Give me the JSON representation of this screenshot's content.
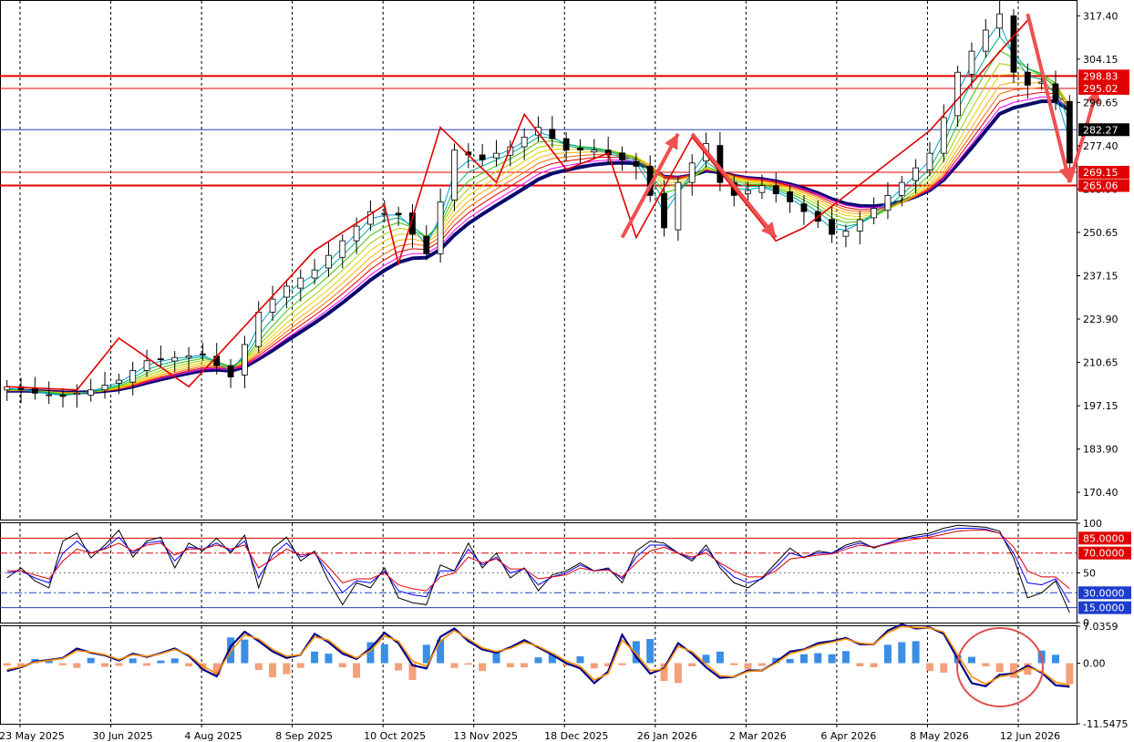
{
  "chart_data": [
    {
      "panel": "price",
      "type": "candlestick",
      "ylim": [
        162.0,
        322.0
      ],
      "y_ticks": [
        "317.40",
        "304.15",
        "290.65",
        "277.40",
        "263.90",
        "250.65",
        "237.15",
        "223.90",
        "210.65",
        "197.15",
        "183.90",
        "170.40"
      ],
      "x_labels": [
        "23 May 2025",
        "30 Jun 2025",
        "4 Aug 2025",
        "8 Sep 2025",
        "10 Oct 2025",
        "13 Nov 2025",
        "18 Dec 2025",
        "26 Jan 2026",
        "2 Mar 2026",
        "6 Apr 2026",
        "8 May 2026",
        "12 Jun 2026"
      ],
      "horizontal_levels": [
        {
          "label": "298.83",
          "value": 298.83,
          "color": "#e00000"
        },
        {
          "label": "295.02",
          "value": 295.02,
          "color": "#e00000"
        },
        {
          "label": "282.27",
          "value": 282.27,
          "color": "#2040c0"
        },
        {
          "label": "269.15",
          "value": 269.15,
          "color": "#e00000"
        },
        {
          "label": "265.06",
          "value": 265.06,
          "color": "#e00000"
        }
      ],
      "close_anchors": [
        [
          0,
          203
        ],
        [
          2,
          201
        ],
        [
          4,
          200
        ],
        [
          6,
          202
        ],
        [
          8,
          205
        ],
        [
          10,
          211
        ],
        [
          12,
          212
        ],
        [
          14,
          213
        ],
        [
          16,
          206
        ],
        [
          18,
          226
        ],
        [
          20,
          234
        ],
        [
          22,
          239
        ],
        [
          24,
          248
        ],
        [
          26,
          257
        ],
        [
          28,
          256
        ],
        [
          30,
          244
        ],
        [
          32,
          276
        ],
        [
          34,
          273
        ],
        [
          36,
          277
        ],
        [
          38,
          283
        ],
        [
          40,
          276
        ],
        [
          42,
          276
        ],
        [
          44,
          273
        ],
        [
          45,
          271
        ],
        [
          46,
          262
        ],
        [
          47,
          252
        ],
        [
          48,
          266
        ],
        [
          50,
          278
        ],
        [
          51,
          266
        ],
        [
          52,
          262
        ],
        [
          54,
          265
        ],
        [
          56,
          260
        ],
        [
          58,
          254
        ],
        [
          59,
          250
        ],
        [
          60,
          251
        ],
        [
          62,
          258
        ],
        [
          64,
          266
        ],
        [
          66,
          275
        ],
        [
          67,
          286
        ],
        [
          68,
          300
        ],
        [
          70,
          313
        ],
        [
          71,
          318
        ],
        [
          72,
          300
        ],
        [
          73,
          296
        ],
        [
          74,
          297
        ],
        [
          75,
          291
        ],
        [
          76,
          272
        ]
      ],
      "trend_zigzag": [
        [
          0,
          203
        ],
        [
          5,
          202
        ],
        [
          8,
          218
        ],
        [
          13,
          203
        ],
        [
          22,
          245
        ],
        [
          27,
          259
        ],
        [
          28,
          241
        ],
        [
          31,
          283
        ],
        [
          35,
          266
        ],
        [
          37,
          287
        ],
        [
          40,
          270
        ],
        [
          43,
          275
        ],
        [
          45,
          249
        ],
        [
          49,
          280
        ],
        [
          55,
          248
        ],
        [
          57,
          252
        ],
        [
          66,
          282
        ],
        [
          73,
          316
        ]
      ],
      "forecast_arrows": [
        [
          [
            44,
            249
          ],
          [
            48,
            281
          ]
        ],
        [
          [
            49,
            281
          ],
          [
            55,
            249
          ]
        ],
        [
          [
            73,
            318
          ],
          [
            76,
            266
          ]
        ],
        [
          [
            76,
            266
          ],
          [
            78,
            295
          ]
        ]
      ],
      "ma_ribbon_colors": [
        "#0a0a6e",
        "#ff00ff",
        "#e00000",
        "#ff6600",
        "#ffb000",
        "#e8d000",
        "#a0d000",
        "#40c000",
        "#00b080",
        "#00a0d0"
      ],
      "x_count": 77
    },
    {
      "panel": "stochastic",
      "type": "line",
      "ylim": [
        0,
        100
      ],
      "y_ticks": [
        "100",
        "50",
        "0"
      ],
      "levels": [
        {
          "label": "85.0000",
          "value": 85,
          "color": "#e00000"
        },
        {
          "label": "70.0000",
          "value": 70,
          "color": "#e00000"
        },
        {
          "label": "30.0000",
          "value": 30,
          "color": "#2040c0"
        },
        {
          "label": "15.0000",
          "value": 15,
          "color": "#2040c0"
        }
      ],
      "series": [
        {
          "color": "#000000",
          "values": [
            45,
            55,
            42,
            35,
            82,
            90,
            65,
            78,
            93,
            66,
            82,
            86,
            55,
            80,
            72,
            85,
            70,
            88,
            35,
            75,
            86,
            62,
            72,
            42,
            18,
            40,
            35,
            55,
            25,
            20,
            18,
            58,
            52,
            80,
            55,
            70,
            45,
            55,
            32,
            48,
            52,
            60,
            52,
            55,
            40,
            72,
            82,
            80,
            70,
            62,
            78,
            55,
            40,
            35,
            45,
            60,
            75,
            65,
            72,
            70,
            78,
            82,
            75,
            80,
            85,
            88,
            90,
            95,
            98,
            97,
            96,
            92,
            65,
            25,
            30,
            42,
            10
          ]
        },
        {
          "color": "#0000ff",
          "values": [
            50,
            52,
            45,
            40,
            70,
            82,
            70,
            75,
            86,
            70,
            80,
            82,
            62,
            76,
            74,
            80,
            72,
            82,
            45,
            68,
            80,
            66,
            70,
            50,
            30,
            42,
            40,
            52,
            32,
            28,
            26,
            52,
            52,
            74,
            58,
            66,
            50,
            54,
            38,
            46,
            50,
            58,
            52,
            54,
            44,
            66,
            78,
            78,
            70,
            64,
            74,
            58,
            46,
            40,
            44,
            56,
            70,
            66,
            70,
            70,
            76,
            80,
            76,
            80,
            84,
            86,
            88,
            92,
            95,
            95,
            94,
            90,
            70,
            40,
            38,
            44,
            20
          ]
        },
        {
          "color": "#e00000",
          "values": [
            52,
            52,
            48,
            44,
            62,
            74,
            70,
            74,
            80,
            72,
            78,
            80,
            68,
            74,
            74,
            78,
            74,
            78,
            55,
            64,
            74,
            68,
            70,
            56,
            40,
            44,
            44,
            50,
            38,
            34,
            32,
            46,
            50,
            66,
            60,
            64,
            54,
            54,
            44,
            46,
            48,
            55,
            52,
            53,
            46,
            60,
            72,
            76,
            70,
            66,
            70,
            60,
            52,
            46,
            46,
            52,
            64,
            66,
            68,
            69,
            74,
            78,
            76,
            79,
            82,
            84,
            86,
            89,
            92,
            93,
            93,
            90,
            76,
            52,
            46,
            46,
            34
          ]
        }
      ],
      "x_count": 77
    },
    {
      "panel": "macd",
      "type": "bar",
      "ylim": [
        -11.5475,
        7.0359
      ],
      "y_ticks": [
        "7.0359",
        "0.00",
        "-11.5475"
      ],
      "histogram": [
        -0.5,
        -0.6,
        0.8,
        0.6,
        -0.4,
        -0.9,
        1.0,
        -0.7,
        -0.5,
        0.9,
        -0.5,
        0.5,
        0.9,
        -0.6,
        -1.2,
        -2.4,
        4.9,
        4.5,
        -1.3,
        -2.7,
        -2.1,
        -0.9,
        2.2,
        1.8,
        -0.8,
        -2.8,
        4.0,
        3.6,
        -1.4,
        -3.2,
        3.5,
        4.5,
        -0.9,
        -0.3,
        -1.5,
        2.1,
        -0.8,
        -0.8,
        1.1,
        1.8,
        -0.5,
        1.3,
        -1.0,
        -0.6,
        -0.4,
        4.2,
        4.6,
        -3.4,
        -3.8,
        -0.6,
        1.6,
        2.2,
        -0.4,
        -1.2,
        -0.5,
        1.0,
        0.8,
        1.7,
        1.9,
        1.7,
        2.3,
        -0.6,
        -0.8,
        3.5,
        4.0,
        4.2,
        -1.5,
        -1.8,
        1.5,
        1.2,
        -0.6,
        -1.7,
        -2.8,
        -2.2,
        2.4,
        1.6,
        -4.0
      ],
      "series": [
        {
          "color": "#00008b",
          "values": [
            -1.5,
            -0.8,
            0.3,
            0.6,
            1.0,
            2.8,
            2.0,
            1.5,
            0.5,
            1.8,
            1.2,
            1.9,
            2.8,
            1.4,
            -1.2,
            -2.5,
            3.2,
            6.0,
            4.2,
            2.2,
            1.0,
            1.6,
            5.6,
            4.0,
            1.8,
            0.8,
            2.8,
            5.8,
            3.8,
            -0.4,
            -1.0,
            5.0,
            6.6,
            4.2,
            2.6,
            2.0,
            3.0,
            4.4,
            3.0,
            1.6,
            0.0,
            -1.0,
            -3.8,
            -1.6,
            5.4,
            1.2,
            -2.0,
            -1.0,
            3.8,
            1.8,
            -0.8,
            -2.8,
            -2.6,
            -1.4,
            -1.4,
            0.2,
            2.2,
            2.6,
            3.8,
            4.2,
            4.8,
            3.6,
            3.6,
            6.2,
            7.4,
            6.6,
            6.8,
            5.6,
            0.8,
            -3.8,
            -4.4,
            -2.2,
            -2.0,
            -0.5,
            -1.8,
            -4.2,
            -4.5
          ]
        },
        {
          "color": "#ff8c00",
          "values": [
            -1.2,
            -0.7,
            0.2,
            0.5,
            0.9,
            2.4,
            2.1,
            1.6,
            0.7,
            1.6,
            1.3,
            1.8,
            2.6,
            1.6,
            -0.6,
            -2.0,
            2.2,
            5.4,
            4.6,
            2.6,
            1.3,
            1.6,
            5.0,
            4.4,
            2.2,
            1.0,
            2.4,
            5.2,
            4.2,
            0.4,
            -0.6,
            4.2,
            6.2,
            4.6,
            2.9,
            2.2,
            2.8,
            4.0,
            3.2,
            1.9,
            0.4,
            -0.6,
            -3.2,
            -2.0,
            4.4,
            1.8,
            -1.4,
            -1.2,
            3.2,
            2.2,
            -0.2,
            -2.4,
            -2.6,
            -1.6,
            -1.4,
            0.0,
            1.8,
            2.5,
            3.5,
            4.0,
            4.6,
            3.8,
            3.6,
            5.8,
            7.0,
            6.8,
            6.7,
            5.9,
            1.6,
            -2.6,
            -4.0,
            -2.6,
            -2.1,
            -0.8,
            -1.6,
            -3.6,
            -4.2
          ]
        }
      ],
      "x_count": 77
    }
  ]
}
